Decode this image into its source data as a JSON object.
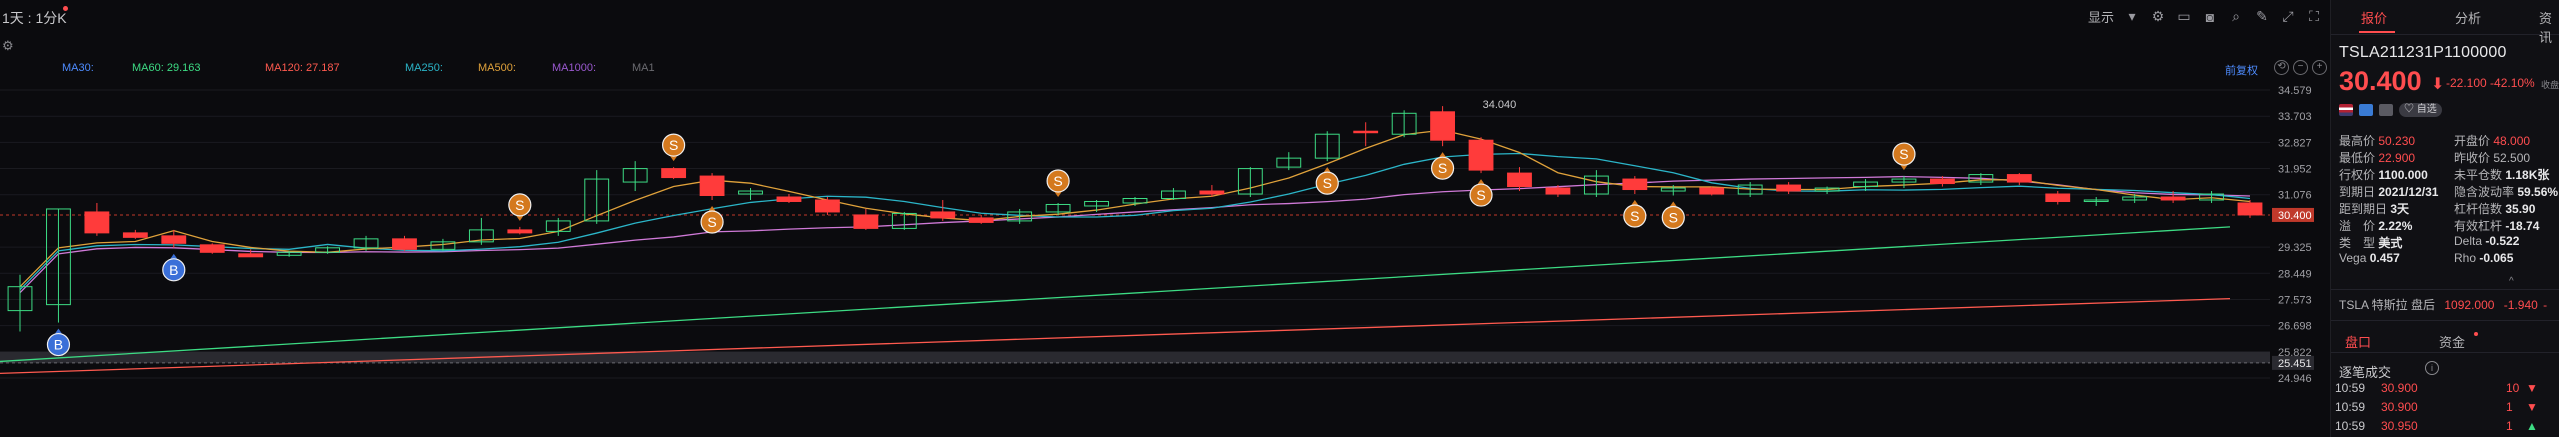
{
  "header": {
    "period": "1天 : 1分K",
    "display_label": "显示"
  },
  "ma_legend": [
    {
      "label": "MA30:",
      "color": "#4e8cff"
    },
    {
      "label": "MA60: 29.163",
      "color": "#3ddc84"
    },
    {
      "label": "MA120: 27.187",
      "color": "#ff5a4f"
    },
    {
      "label": "MA250:",
      "color": "#2bb5c8"
    },
    {
      "label": "MA500:",
      "color": "#e0a23b"
    },
    {
      "label": "MA1000:",
      "color": "#9b59d0"
    },
    {
      "label": "MA1",
      "color": "#6b6b70"
    }
  ],
  "fuquan_label": "前复权",
  "chart_data": {
    "type": "candlestick",
    "price_axis_ticks": [
      "34.579",
      "33.703",
      "32.827",
      "31.952",
      "31.076",
      "30.400",
      "29.325",
      "28.449",
      "27.573",
      "26.698",
      "25.822",
      "25.451",
      "24.946"
    ],
    "current_price": "30.400",
    "high_label": "34.040",
    "candles": [
      {
        "o": 27.2,
        "h": 28.4,
        "l": 26.5,
        "c": 28.0
      },
      {
        "o": 27.4,
        "h": 30.6,
        "l": 26.8,
        "c": 30.6
      },
      {
        "o": 30.5,
        "h": 30.8,
        "l": 29.7,
        "c": 29.8
      },
      {
        "o": 29.8,
        "h": 29.9,
        "l": 29.6,
        "c": 29.65
      },
      {
        "o": 29.7,
        "h": 29.9,
        "l": 29.3,
        "c": 29.45
      },
      {
        "o": 29.4,
        "h": 29.45,
        "l": 29.1,
        "c": 29.15
      },
      {
        "o": 29.1,
        "h": 29.25,
        "l": 29.0,
        "c": 29.0
      },
      {
        "o": 29.05,
        "h": 29.2,
        "l": 29.0,
        "c": 29.15
      },
      {
        "o": 29.15,
        "h": 29.35,
        "l": 29.1,
        "c": 29.3
      },
      {
        "o": 29.3,
        "h": 29.7,
        "l": 29.2,
        "c": 29.6
      },
      {
        "o": 29.6,
        "h": 29.7,
        "l": 29.2,
        "c": 29.25
      },
      {
        "o": 29.25,
        "h": 29.6,
        "l": 29.2,
        "c": 29.5
      },
      {
        "o": 29.5,
        "h": 30.3,
        "l": 29.4,
        "c": 29.9
      },
      {
        "o": 29.9,
        "h": 30.0,
        "l": 29.75,
        "c": 29.8
      },
      {
        "o": 29.85,
        "h": 30.3,
        "l": 29.7,
        "c": 30.2
      },
      {
        "o": 30.2,
        "h": 31.9,
        "l": 30.1,
        "c": 31.6
      },
      {
        "o": 31.5,
        "h": 32.2,
        "l": 31.2,
        "c": 31.95
      },
      {
        "o": 31.95,
        "h": 32.0,
        "l": 31.6,
        "c": 31.65
      },
      {
        "o": 31.7,
        "h": 31.8,
        "l": 30.9,
        "c": 31.05
      },
      {
        "o": 31.1,
        "h": 31.3,
        "l": 30.9,
        "c": 31.2
      },
      {
        "o": 31.0,
        "h": 31.1,
        "l": 30.8,
        "c": 30.85
      },
      {
        "o": 30.9,
        "h": 31.0,
        "l": 30.4,
        "c": 30.5
      },
      {
        "o": 30.4,
        "h": 30.6,
        "l": 29.9,
        "c": 29.95
      },
      {
        "o": 29.95,
        "h": 30.5,
        "l": 29.9,
        "c": 30.45
      },
      {
        "o": 30.5,
        "h": 30.9,
        "l": 30.2,
        "c": 30.3
      },
      {
        "o": 30.3,
        "h": 30.4,
        "l": 30.1,
        "c": 30.15
      },
      {
        "o": 30.2,
        "h": 30.6,
        "l": 30.1,
        "c": 30.5
      },
      {
        "o": 30.5,
        "h": 30.8,
        "l": 30.4,
        "c": 30.75
      },
      {
        "o": 30.7,
        "h": 30.9,
        "l": 30.5,
        "c": 30.85
      },
      {
        "o": 30.8,
        "h": 31.0,
        "l": 30.7,
        "c": 30.95
      },
      {
        "o": 30.95,
        "h": 31.3,
        "l": 30.9,
        "c": 31.2
      },
      {
        "o": 31.2,
        "h": 31.4,
        "l": 31.0,
        "c": 31.1
      },
      {
        "o": 31.1,
        "h": 32.0,
        "l": 31.0,
        "c": 31.95
      },
      {
        "o": 32.0,
        "h": 32.5,
        "l": 31.9,
        "c": 32.3
      },
      {
        "o": 32.3,
        "h": 33.2,
        "l": 32.2,
        "c": 33.1
      },
      {
        "o": 33.2,
        "h": 33.5,
        "l": 32.7,
        "c": 33.15
      },
      {
        "o": 33.1,
        "h": 33.9,
        "l": 33.0,
        "c": 33.8
      },
      {
        "o": 33.85,
        "h": 34.04,
        "l": 32.7,
        "c": 32.9
      },
      {
        "o": 32.9,
        "h": 33.0,
        "l": 31.8,
        "c": 31.9
      },
      {
        "o": 31.8,
        "h": 32.0,
        "l": 31.2,
        "c": 31.35
      },
      {
        "o": 31.3,
        "h": 31.4,
        "l": 31.0,
        "c": 31.1
      },
      {
        "o": 31.1,
        "h": 31.9,
        "l": 31.0,
        "c": 31.7
      },
      {
        "o": 31.6,
        "h": 31.7,
        "l": 31.1,
        "c": 31.25
      },
      {
        "o": 31.2,
        "h": 31.4,
        "l": 31.05,
        "c": 31.3
      },
      {
        "o": 31.3,
        "h": 31.35,
        "l": 31.05,
        "c": 31.1
      },
      {
        "o": 31.1,
        "h": 31.5,
        "l": 31.0,
        "c": 31.4
      },
      {
        "o": 31.4,
        "h": 31.5,
        "l": 31.1,
        "c": 31.2
      },
      {
        "o": 31.2,
        "h": 31.35,
        "l": 31.1,
        "c": 31.3
      },
      {
        "o": 31.35,
        "h": 31.6,
        "l": 31.2,
        "c": 31.5
      },
      {
        "o": 31.5,
        "h": 31.7,
        "l": 31.3,
        "c": 31.6
      },
      {
        "o": 31.6,
        "h": 31.7,
        "l": 31.35,
        "c": 31.45
      },
      {
        "o": 31.5,
        "h": 31.8,
        "l": 31.4,
        "c": 31.75
      },
      {
        "o": 31.75,
        "h": 31.8,
        "l": 31.4,
        "c": 31.5
      },
      {
        "o": 31.1,
        "h": 31.2,
        "l": 30.75,
        "c": 30.85
      },
      {
        "o": 30.85,
        "h": 31.0,
        "l": 30.7,
        "c": 30.9
      },
      {
        "o": 30.9,
        "h": 31.1,
        "l": 30.8,
        "c": 31.0
      },
      {
        "o": 31.0,
        "h": 31.2,
        "l": 30.8,
        "c": 30.9
      },
      {
        "o": 30.9,
        "h": 31.2,
        "l": 30.8,
        "c": 31.1
      },
      {
        "o": 30.8,
        "h": 30.9,
        "l": 30.3,
        "c": 30.4
      }
    ],
    "markers": [
      {
        "text": "B",
        "index": 1,
        "color": "#3a6fd8",
        "pos": "below"
      },
      {
        "text": "B",
        "index": 4,
        "color": "#3a6fd8",
        "pos": "below"
      },
      {
        "text": "S",
        "index": 13,
        "color": "#d4791e",
        "pos": "above"
      },
      {
        "text": "S",
        "index": 17,
        "color": "#d4791e",
        "pos": "above"
      },
      {
        "text": "S",
        "index": 18,
        "color": "#d4791e",
        "pos": "below"
      },
      {
        "text": "S",
        "index": 27,
        "color": "#d4791e",
        "pos": "above"
      },
      {
        "text": "S",
        "index": 34,
        "color": "#d4791e",
        "pos": "below"
      },
      {
        "text": "S",
        "index": 37,
        "color": "#d4791e",
        "pos": "below"
      },
      {
        "text": "S",
        "index": 38,
        "color": "#d4791e",
        "pos": "below"
      },
      {
        "text": "S",
        "index": 42,
        "color": "#d4791e",
        "pos": "below"
      },
      {
        "text": "S",
        "index": 43,
        "color": "#d4791e",
        "pos": "below"
      },
      {
        "text": "S",
        "index": 49,
        "color": "#d4791e",
        "pos": "above"
      }
    ]
  },
  "panel": {
    "tabs": [
      "报价",
      "分析",
      "资讯"
    ],
    "symbol": "TSLA211231P1100000",
    "price": "30.400",
    "arrow": "⬇",
    "change": "-22.100 -42.10%",
    "change_suffix": "收盘",
    "fav_label": "♡ 自选",
    "stats": [
      {
        "l_label": "最高价",
        "l_value": "50.230",
        "l_class": "v-red",
        "r_label": "开盘价",
        "r_value": "48.000",
        "r_class": "v-red"
      },
      {
        "l_label": "最低价",
        "l_value": "22.900",
        "l_class": "v-red",
        "r_label": "昨收价",
        "r_value": "52.500",
        "r_class": "lbl"
      },
      {
        "l_label": "行权价",
        "l_value": "1100.000",
        "l_class": "v-white",
        "r_label": "未平仓数",
        "r_value": "1.18K张",
        "r_class": "v-white"
      },
      {
        "l_label": "到期日",
        "l_value": "2021/12/31",
        "l_class": "v-white",
        "r_label": "隐含波动率",
        "r_value": "59.56%",
        "r_class": "v-white"
      },
      {
        "l_label": "距到期日",
        "l_value": "3天",
        "l_class": "v-white",
        "r_label": "杠杆倍数",
        "r_value": "35.90",
        "r_class": "v-white"
      },
      {
        "l_label": "溢　价",
        "l_value": "2.22%",
        "l_class": "v-white",
        "r_label": "有效杠杆",
        "r_value": "-18.74",
        "r_class": "v-white"
      },
      {
        "l_label": "类　型",
        "l_value": "美式",
        "l_class": "v-white",
        "r_label": "Delta",
        "r_value": "-0.522",
        "r_class": "v-white"
      },
      {
        "l_label": "Vega",
        "l_value": "0.457",
        "l_class": "v-white",
        "r_label": "Rho",
        "r_value": "-0.065",
        "r_class": "v-white"
      }
    ],
    "underlying": {
      "name": "TSLA 特斯拉 盘后",
      "price": "1092.000",
      "change": "-1.940",
      "suffix": "-"
    },
    "subtabs": [
      "盘口",
      "资金"
    ],
    "trades_header": "逐笔成交",
    "trades": [
      {
        "time": "10:59",
        "price": "30.900",
        "qty": "10",
        "dir": "▼"
      },
      {
        "time": "10:59",
        "price": "30.900",
        "qty": "1",
        "dir": "▼"
      },
      {
        "time": "10:59",
        "price": "30.950",
        "qty": "1",
        "dir": "▲"
      }
    ]
  }
}
